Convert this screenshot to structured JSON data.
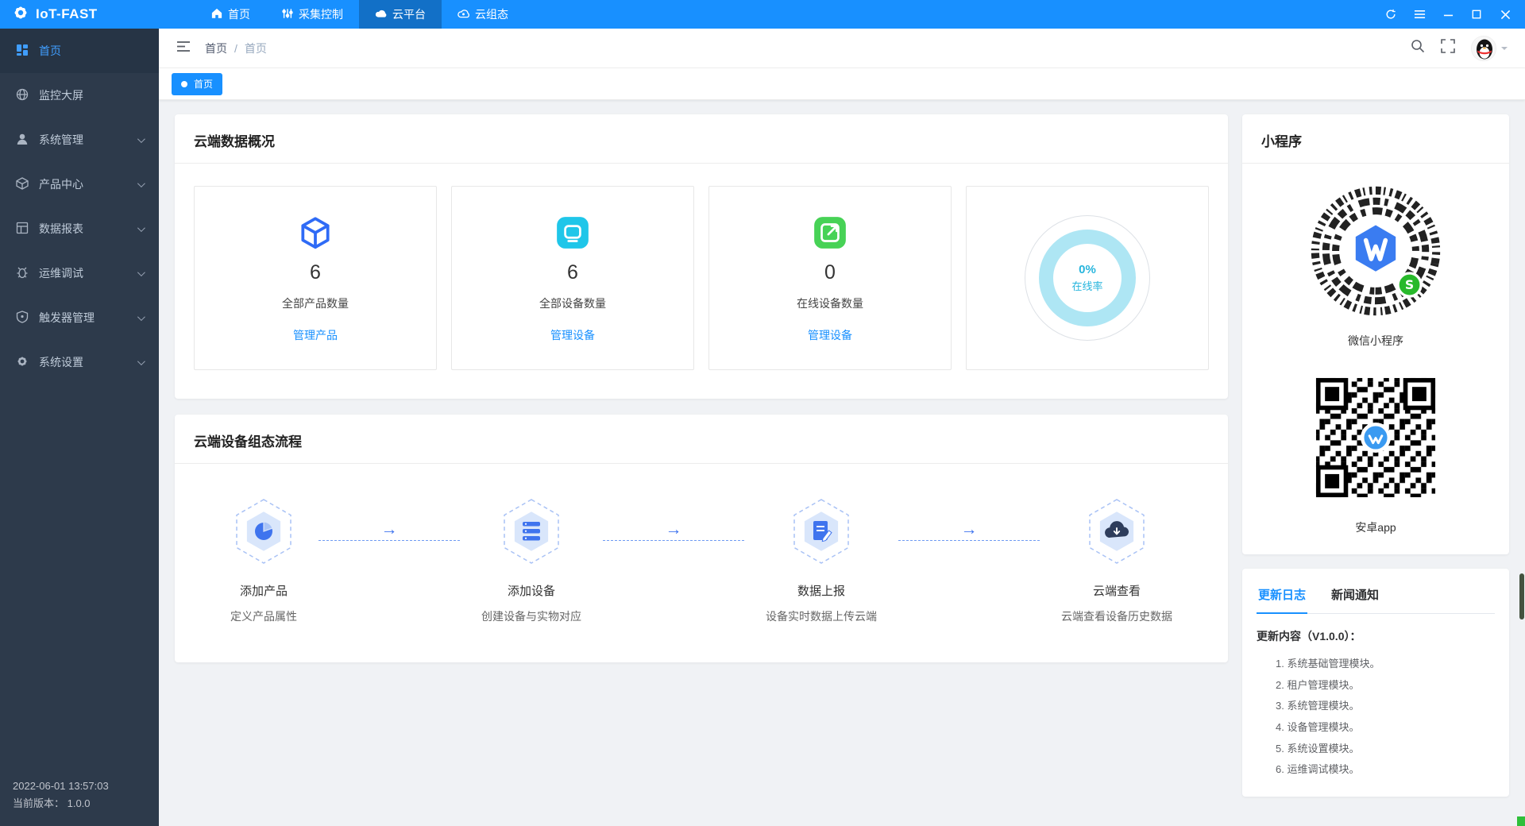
{
  "topbar": {
    "logo_text": "IoT-FAST",
    "nav": [
      {
        "label": "首页",
        "icon": "home-icon",
        "active": false
      },
      {
        "label": "采集控制",
        "icon": "collect-control-icon",
        "active": false
      },
      {
        "label": "云平台",
        "icon": "cloud-platform-icon",
        "active": true
      },
      {
        "label": "云组态",
        "icon": "cloud-config-icon",
        "active": false
      }
    ],
    "window_controls": [
      "refresh",
      "menu",
      "minimize",
      "maximize",
      "close"
    ]
  },
  "sidebar": {
    "items": [
      {
        "label": "首页",
        "icon": "dashboard-icon",
        "active": true,
        "expandable": false
      },
      {
        "label": "监控大屏",
        "icon": "monitor-screen-icon",
        "active": false,
        "expandable": false
      },
      {
        "label": "系统管理",
        "icon": "user-icon",
        "active": false,
        "expandable": true
      },
      {
        "label": "产品中心",
        "icon": "product-icon",
        "active": false,
        "expandable": true
      },
      {
        "label": "数据报表",
        "icon": "report-icon",
        "active": false,
        "expandable": true
      },
      {
        "label": "运维调试",
        "icon": "debug-icon",
        "active": false,
        "expandable": true
      },
      {
        "label": "触发器管理",
        "icon": "trigger-icon",
        "active": false,
        "expandable": true
      },
      {
        "label": "系统设置",
        "icon": "settings-icon",
        "active": false,
        "expandable": true
      }
    ],
    "footer": {
      "datetime": "2022-06-01 13:57:03",
      "version": "当前版本： 1.0.0"
    }
  },
  "header": {
    "breadcrumb": [
      "首页",
      "首页"
    ],
    "separator": "/"
  },
  "tabs": [
    {
      "label": "首页",
      "active": true
    }
  ],
  "overview": {
    "title": "云端数据概况",
    "stats": [
      {
        "icon": "product-cube-icon",
        "color": "#2f6bf6",
        "value": "6",
        "label": "全部产品数量",
        "link": "管理产品"
      },
      {
        "icon": "device-icon",
        "color": "#1fc6e9",
        "value": "6",
        "label": "全部设备数量",
        "link": "管理设备"
      },
      {
        "icon": "online-device-icon",
        "color": "#47d256",
        "value": "0",
        "label": "在线设备数量",
        "link": "管理设备"
      }
    ],
    "donut": {
      "percent": "0%",
      "label": "在线率",
      "ring_color": "#aee6f4",
      "text_color": "#27b5dd"
    }
  },
  "flow": {
    "title": "云端设备组态流程",
    "arrow": "→",
    "steps": [
      {
        "icon": "add-product-icon",
        "title": "添加产品",
        "desc": "定义产品属性"
      },
      {
        "icon": "add-device-icon",
        "title": "添加设备",
        "desc": "创建设备与实物对应"
      },
      {
        "icon": "data-report-icon",
        "title": "数据上报",
        "desc": "设备实时数据上传云端"
      },
      {
        "icon": "cloud-view-icon",
        "title": "云端查看",
        "desc": "云端查看设备历史数据"
      }
    ]
  },
  "miniprogram": {
    "title": "小程序",
    "wechat_label": "微信小程序",
    "android_label": "安卓app"
  },
  "changelog": {
    "tabs": [
      {
        "label": "更新日志",
        "active": true
      },
      {
        "label": "新闻通知",
        "active": false
      }
    ],
    "heading": "更新内容（V1.0.0）：",
    "items": [
      "1. 系统基础管理模块。",
      "2. 租户管理模块。",
      "3. 系统管理模块。",
      "4. 设备管理模块。",
      "5. 系统设置模块。",
      "6. 运维调试模块。"
    ]
  },
  "colors": {
    "topbar": "#1890ff",
    "sidebar_bg": "#2d3a4b",
    "active_blue": "#409eff",
    "link": "#1890ff",
    "content_bg": "#f0f2f5"
  }
}
